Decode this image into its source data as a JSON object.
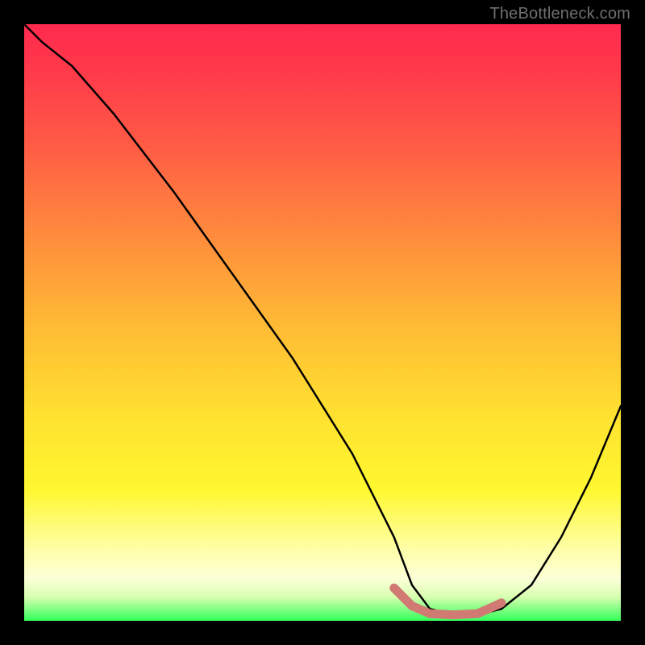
{
  "watermark": "TheBottleneck.com",
  "chart_data": {
    "type": "line",
    "title": "",
    "xlabel": "",
    "ylabel": "",
    "xlim": [
      0,
      100
    ],
    "ylim": [
      0,
      100
    ],
    "series": [
      {
        "name": "bottleneck-curve",
        "color": "#000000",
        "x": [
          0,
          3,
          8,
          15,
          25,
          35,
          45,
          55,
          62,
          65,
          68,
          72,
          76,
          80,
          85,
          90,
          95,
          100
        ],
        "values": [
          100,
          97,
          93,
          85,
          72,
          58,
          44,
          28,
          14,
          6,
          2,
          1,
          1,
          2,
          6,
          14,
          24,
          36
        ]
      },
      {
        "name": "optimal-range-highlight",
        "color": "#d17a74",
        "x": [
          62,
          65,
          68,
          72,
          76,
          80
        ],
        "values": [
          5.5,
          2.5,
          1.2,
          1.0,
          1.2,
          3.0
        ]
      }
    ],
    "grid": false,
    "legend": false
  }
}
